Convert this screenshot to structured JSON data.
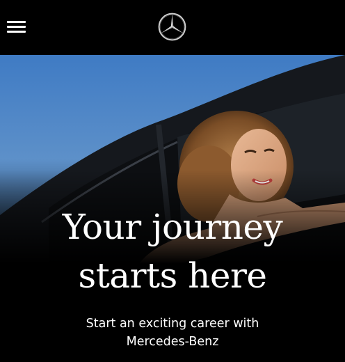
{
  "header": {
    "menu_icon": "hamburger-menu-icon",
    "logo_icon": "three-pointed-star-logo"
  },
  "hero": {
    "image_subject": "woman-in-car-window-photo",
    "title_line1": "Your journey",
    "title_line2": "starts here",
    "subtitle_line1": "Start an exciting career with",
    "subtitle_line2": "Mercedes-Benz"
  },
  "colors": {
    "background": "#000000",
    "text": "#ffffff",
    "sky": "#4f86c9"
  }
}
